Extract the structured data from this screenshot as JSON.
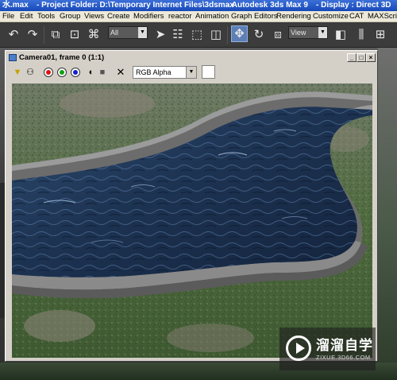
{
  "window": {
    "file": "水.max",
    "project": "- Project Folder: D:\\Temporary Internet Files\\3dsmax",
    "app": "- Autodesk 3ds Max 9",
    "display": "- Display : Direct 3D"
  },
  "menu": [
    "File",
    "Edit",
    "Tools",
    "Group",
    "Views",
    "Create",
    "Modifiers",
    "reactor",
    "Animation",
    "Graph Editors",
    "Rendering",
    "Customize",
    "CAT",
    "MAXScript"
  ],
  "toolbar": {
    "selection_filter": "All",
    "reference_coord": "View",
    "icons": [
      "undo-icon",
      "redo-icon",
      "select-link-icon",
      "unlink-icon",
      "bind-spacewarp-icon",
      "select-object-icon",
      "select-by-name-icon",
      "region-select-icon",
      "window-crossing-icon",
      "move-icon",
      "rotate-icon",
      "scale-icon",
      "pivot-icon",
      "mirror-icon",
      "align-icon"
    ]
  },
  "viewport_window": {
    "title": "Camera01, frame 0 (1:1)",
    "buttons": [
      "minimize",
      "maximize",
      "close"
    ],
    "channel": "RGB Alpha",
    "colors": {
      "red": "#e01010",
      "green": "#10a010",
      "blue": "#1020d0"
    }
  },
  "watermark": {
    "title": "溜溜自学",
    "url": "ZIXUE.3D66.COM"
  }
}
